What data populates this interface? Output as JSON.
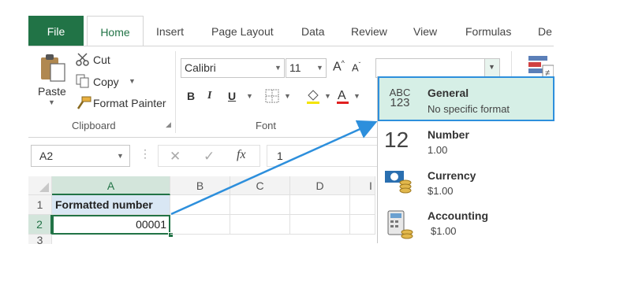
{
  "tabs": [
    "File",
    "Home",
    "Insert",
    "Page Layout",
    "Data",
    "Review",
    "View",
    "Formulas",
    "De"
  ],
  "clipboard": {
    "paste_label": "Paste",
    "cut_label": "Cut",
    "copy_label": "Copy",
    "format_painter_label": "Format Painter",
    "group_label": "Clipboard"
  },
  "font": {
    "family": "Calibri",
    "size": "11",
    "group_label": "Font",
    "bold": "B",
    "italic": "I",
    "underline": "U"
  },
  "formula_bar": {
    "name_box": "A2",
    "fx": "fx",
    "value": "1"
  },
  "grid": {
    "columns": [
      "A",
      "B",
      "C",
      "D",
      "I"
    ],
    "rows": [
      "1",
      "2",
      "3"
    ],
    "a1": "Formatted number",
    "a2": "00001"
  },
  "number_formats": [
    {
      "icon": "abc-123-icon",
      "title": "General",
      "subtitle": "No specific format",
      "selected": true
    },
    {
      "icon": "number-12-icon",
      "title": "Number",
      "subtitle": "1.00"
    },
    {
      "icon": "currency-icon",
      "title": "Currency",
      "subtitle": "$1.00"
    },
    {
      "icon": "accounting-icon",
      "title": "Accounting",
      "subtitle": "$1.00"
    }
  ],
  "icons": {
    "abc_top": "ABC",
    "abc_bottom": "123",
    "num_big": "12"
  },
  "colors": {
    "excel_green": "#217346",
    "selection_blue": "#2d8fdc",
    "selected_fill": "#d6efe6",
    "font_red": "#e02020"
  }
}
